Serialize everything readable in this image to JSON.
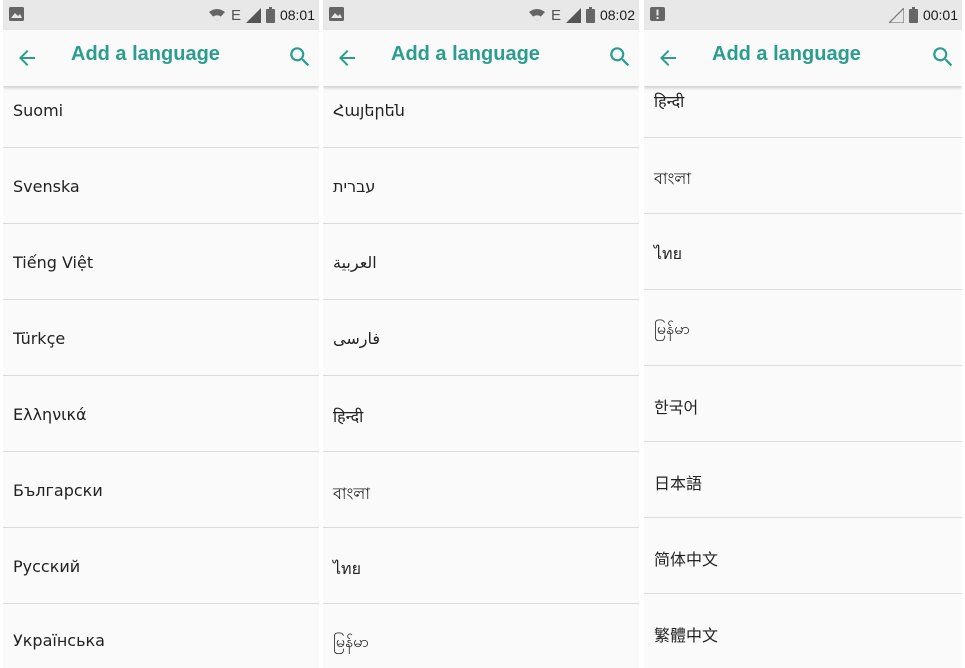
{
  "colors": {
    "accent": "#2a9d8f",
    "divider": "#dcdcdc",
    "statusbar": "#e8e8e8"
  },
  "icons": {
    "back": "arrow-left-icon",
    "search": "search-icon",
    "status_left_0": "image-notification-icon",
    "status_left_2": "alert-notification-icon"
  },
  "panels": [
    {
      "status": {
        "network": "E",
        "time": "08:01"
      },
      "toolbar": {
        "title": "Add a language"
      },
      "languages": [
        "Suomi",
        "Svenska",
        "Tiếng Việt",
        "Türkçe",
        "Ελληνικά",
        "Български",
        "Русский",
        "Українська"
      ]
    },
    {
      "status": {
        "network": "E",
        "time": "08:02"
      },
      "toolbar": {
        "title": "Add a language"
      },
      "languages": [
        "Հայերեն",
        "עברית",
        "العربية",
        "فارسی",
        "हिन्दी",
        "বাংলা",
        "ไทย",
        "မြန်မာ"
      ]
    },
    {
      "status": {
        "network": "",
        "time": "00:01"
      },
      "toolbar": {
        "title": "Add a language"
      },
      "languages": [
        "हिन्दी",
        "বাংলা",
        "ไทย",
        "မြန်မာ",
        "한국어",
        "日本語",
        "简体中文",
        "繁體中文"
      ]
    }
  ]
}
